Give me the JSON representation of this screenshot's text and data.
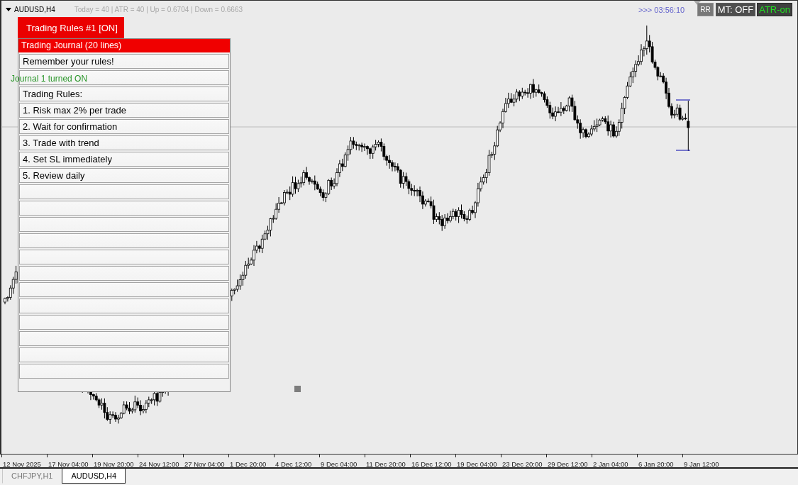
{
  "chart_window": {
    "symbol": "AUDUSD,H4",
    "info": "Today = 40 | ATR = 40 | Up = 0.6704 | Down = 0.6663",
    "countdown": ">>> 03:56:10",
    "rr_button": {
      "label": "RR"
    },
    "toggles": [
      {
        "label": "MT: OFF",
        "on": false
      },
      {
        "label": "ATR-on",
        "on": true
      }
    ]
  },
  "journal_panel": {
    "tab": "Trading Rules #1 [ON]",
    "header": "Trading Journal (20 lines)",
    "lines": [
      {
        "kind": "text",
        "value": "Remember your rules!"
      },
      {
        "kind": "blank"
      },
      {
        "kind": "text",
        "value": "Trading Rules:"
      },
      {
        "kind": "text",
        "value": "1. Risk max 2% per trade"
      },
      {
        "kind": "text",
        "value": "2. Wait for confirmation"
      },
      {
        "kind": "text",
        "value": "3. Trade with trend"
      },
      {
        "kind": "text",
        "value": "4. Set SL immediately"
      },
      {
        "kind": "text",
        "value": "5. Review daily"
      },
      {
        "kind": "blank"
      },
      {
        "kind": "blank"
      },
      {
        "kind": "blank"
      },
      {
        "kind": "blank"
      },
      {
        "kind": "blank"
      },
      {
        "kind": "blank"
      },
      {
        "kind": "blank"
      },
      {
        "kind": "blank"
      },
      {
        "kind": "blank"
      },
      {
        "kind": "blank"
      },
      {
        "kind": "blank"
      },
      {
        "kind": "blank"
      }
    ]
  },
  "status_message": "Journal 1 turned ON",
  "time_axis": [
    "12 Nov 2025",
    "17 Nov 04:00",
    "19 Nov 20:00",
    "24 Nov 12:00",
    "27 Nov 04:00",
    "1 Dec 20:00",
    "4 Dec 12:00",
    "9 Dec 04:00",
    "11 Dec 20:00",
    "16 Dec 12:00",
    "19 Dec 04:00",
    "23 Dec 20:00",
    "29 Dec 12:00",
    "2 Jan 04:00",
    "6 Jan 20:00",
    "9 Jan 12:00"
  ],
  "tabs": [
    {
      "label": "CHFJPY,H1",
      "selected": false
    },
    {
      "label": "AUDUSD,H4",
      "selected": true
    }
  ]
}
